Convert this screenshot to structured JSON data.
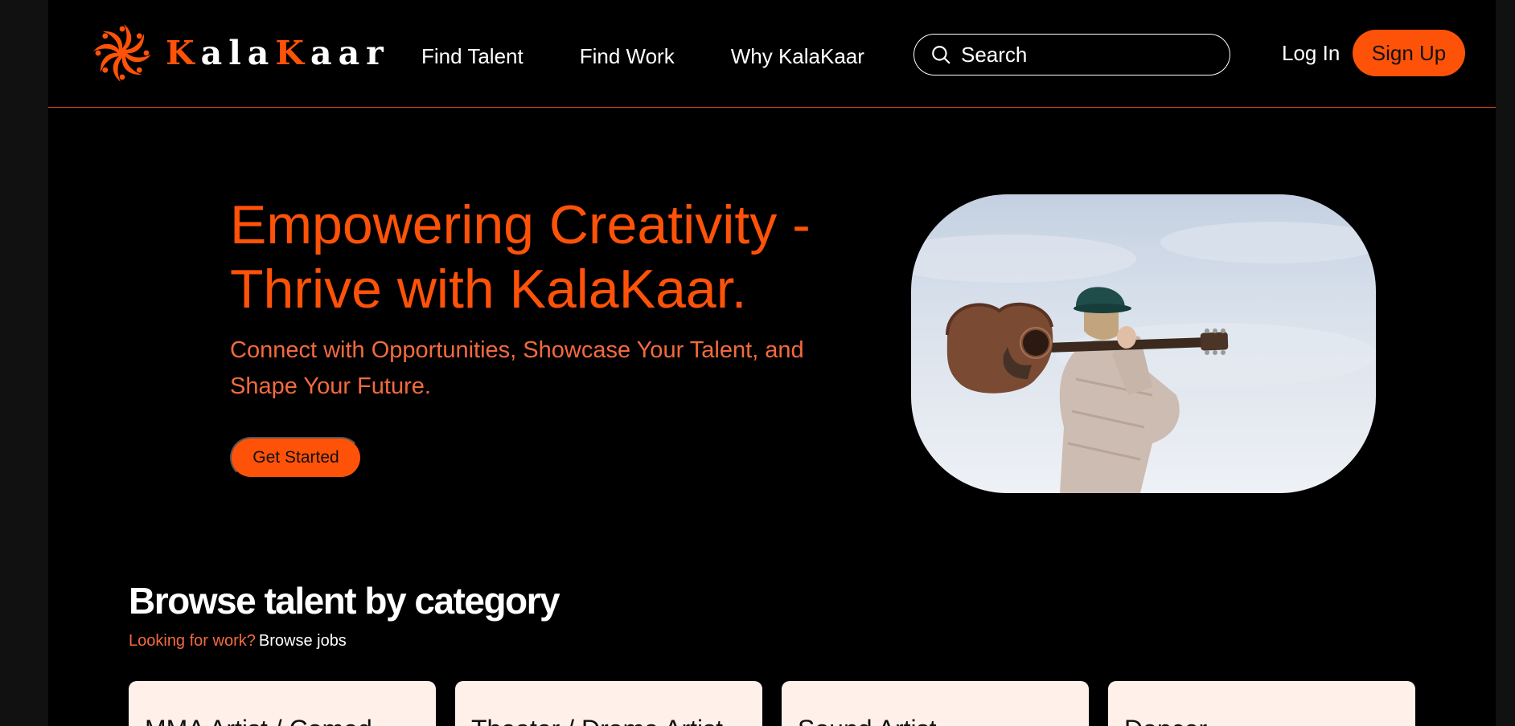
{
  "brand": {
    "name": "KalaKaar",
    "accent": "#ff5209"
  },
  "nav": {
    "items": [
      {
        "label": "Find Talent"
      },
      {
        "label": "Find Work"
      },
      {
        "label": "Why KalaKaar"
      }
    ]
  },
  "search": {
    "placeholder": "Search",
    "icon": "search-icon"
  },
  "auth": {
    "login": "Log In",
    "signup": "Sign Up"
  },
  "hero": {
    "title": "Empowering Creativity - Thrive with KalaKaar.",
    "subtitle": "Connect with Opportunities, Showcase Your Talent, and Shape Your Future.",
    "cta": "Get Started"
  },
  "browse": {
    "title": "Browse talent by category",
    "question": "Looking for work?",
    "link": "Browse jobs",
    "categories": [
      {
        "label": "MMA Artist / Comed"
      },
      {
        "label": "Theater / Drama Artist"
      },
      {
        "label": "Sound Artist"
      },
      {
        "label": "Dancer"
      }
    ]
  }
}
